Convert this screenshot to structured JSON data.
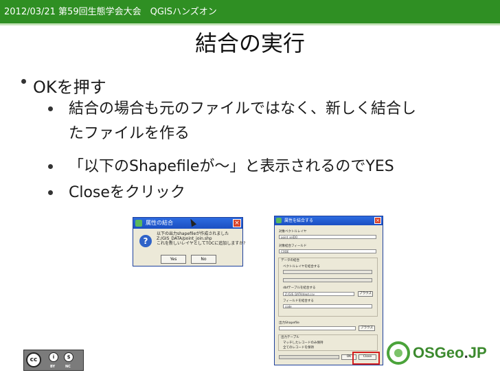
{
  "header": {
    "text": "2012/03/21 第59回生態学会大会　QGISハンズオン"
  },
  "slide": {
    "title": "結合の実行",
    "bullet1": "OKを押す",
    "sub_bullets": [
      {
        "line1": "結合の場合も元のファイルではなく、新しく結合し",
        "line2": "たファイルを作る"
      },
      {
        "line1": "「以下のShapefileが～」と表示されるのでYES"
      },
      {
        "line1": "Closeをクリック"
      }
    ]
  },
  "dialog1": {
    "title": "属性の結合",
    "message_lines": [
      "以下の出力shapefileが作成されました",
      "Z:/GIS_DATA/point_join.shp",
      "これを新しいレイヤとしてTOCに追加しますか?"
    ],
    "yes_label": "Yes",
    "no_label": "No",
    "close_glyph": "×",
    "icon_glyph": "?"
  },
  "dialog2": {
    "title": "属性を結合する",
    "close_glyph": "×",
    "labels": {
      "target_layer": "対象ベクトルレイヤ",
      "target_field": "対象結合フィールド",
      "join_data": "データの結合",
      "join_vector": "ベクトルレイヤを結合する",
      "join_dbf": "dbfテーブルを結合する",
      "join_field": "フィールドを結合する",
      "output_shapefile": "出力Shapefile",
      "output_table": "出力テーブル",
      "keep_matched": "マッチしたレコードのみ保持",
      "keep_all": "全てのレコードを保持"
    },
    "values": {
      "target_layer": "point_selDO",
      "target_field": "CODE",
      "dbf_path": "Z:/GIS_DATA/dept.csv",
      "join_field": "code"
    },
    "buttons": {
      "browse1": "ブラウズ",
      "browse2": "ブラウズ",
      "ok": "OK",
      "close": "Close"
    }
  },
  "footer": {
    "cc_symbol": "cc",
    "by_label": "BY",
    "nc_label": "NC",
    "osgeo_text": "OSGeo",
    "osgeo_dot": ".",
    "osgeo_jp": "JP"
  }
}
